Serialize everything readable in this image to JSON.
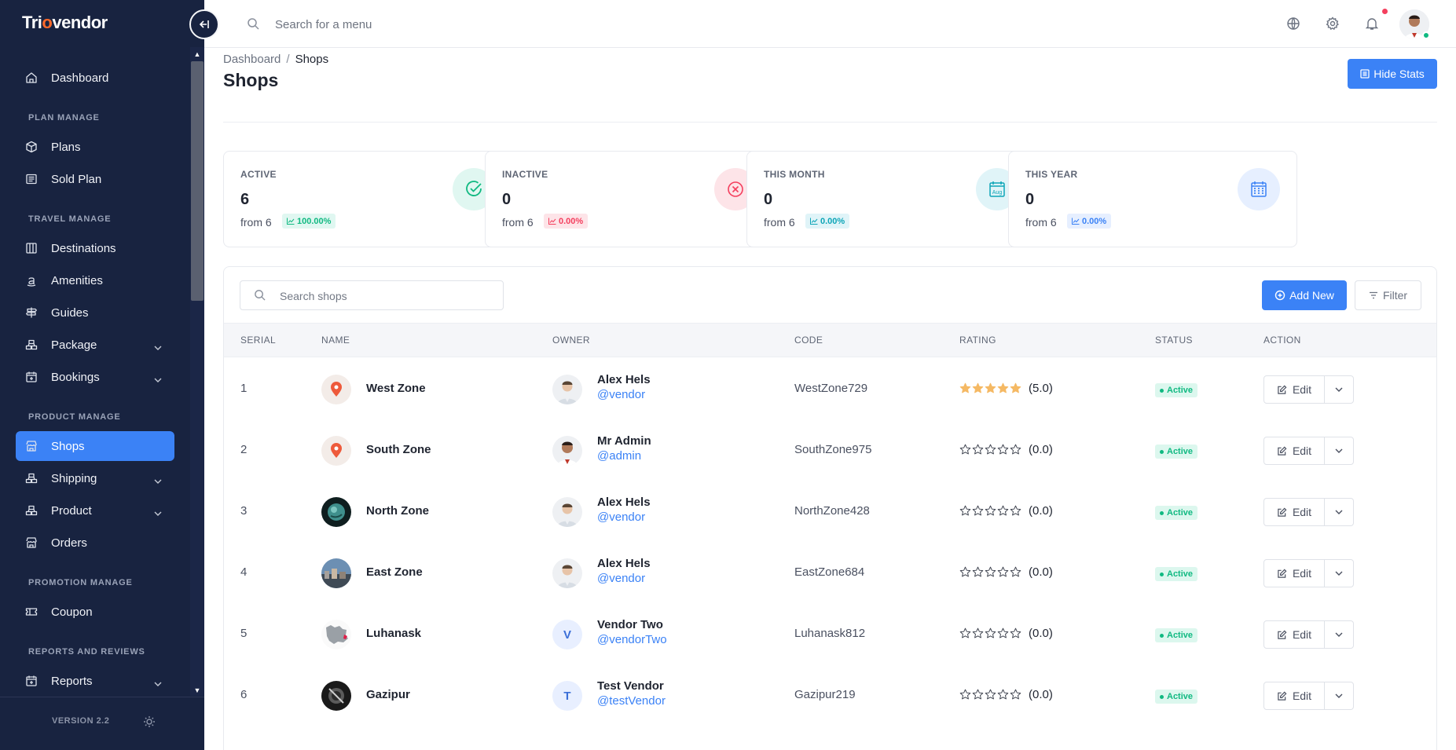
{
  "sidebar": {
    "logo_pre": "Tri",
    "logo_o": "o",
    "logo_post": "vendor",
    "logo_o2": "o",
    "logo_end": "r",
    "items": [
      {
        "label": "Dashboard",
        "icon": "home-icon"
      },
      {
        "section": "PLAN MANAGE"
      },
      {
        "label": "Plans",
        "icon": "cube-icon"
      },
      {
        "label": "Sold Plan",
        "icon": "receipt-icon"
      },
      {
        "section": "TRAVEL MANAGE"
      },
      {
        "label": "Destinations",
        "icon": "columns-icon"
      },
      {
        "label": "Amenities",
        "icon": "amazon-icon"
      },
      {
        "label": "Guides",
        "icon": "signpost-icon"
      },
      {
        "label": "Package",
        "icon": "boxes-icon",
        "expandable": true
      },
      {
        "label": "Bookings",
        "icon": "calendar-plus-icon",
        "expandable": true
      },
      {
        "section": "PRODUCT MANAGE"
      },
      {
        "label": "Shops",
        "icon": "store-icon",
        "active": true
      },
      {
        "label": "Shipping",
        "icon": "boxes-icon",
        "expandable": true
      },
      {
        "label": "Product",
        "icon": "boxes-icon",
        "expandable": true
      },
      {
        "label": "Orders",
        "icon": "store-icon"
      },
      {
        "section": "PROMOTION MANAGE"
      },
      {
        "label": "Coupon",
        "icon": "ticket-icon"
      },
      {
        "section": "REPORTS AND REVIEWS"
      },
      {
        "label": "Reports",
        "icon": "calendar-plus-icon",
        "expandable": true
      }
    ],
    "version": "VERSION 2.2"
  },
  "topbar": {
    "search_placeholder": "Search for a menu"
  },
  "breadcrumb": {
    "parent": "Dashboard",
    "separator": "/",
    "current": "Shops"
  },
  "page_title": "Shops",
  "hide_stats_label": "Hide Stats",
  "stats": [
    {
      "label": "ACTIVE",
      "value": "6",
      "from": "from 6",
      "pct": "100.00%",
      "color": "#10b981",
      "bg": "#e0f7f1",
      "icon": "check-circle-icon"
    },
    {
      "label": "INACTIVE",
      "value": "0",
      "from": "from 6",
      "pct": "0.00%",
      "color": "#f43f5e",
      "bg": "#fde4e8",
      "icon": "x-circle-icon"
    },
    {
      "label": "THIS MONTH",
      "value": "0",
      "from": "from 6",
      "pct": "0.00%",
      "color": "#0ea5b7",
      "bg": "#e0f4f8",
      "icon": "calendar-month-icon"
    },
    {
      "label": "THIS YEAR",
      "value": "0",
      "from": "from 6",
      "pct": "0.00%",
      "color": "#3b82f6",
      "bg": "#e6efff",
      "icon": "calendar-grid-icon"
    }
  ],
  "table": {
    "search_placeholder": "Search shops",
    "add_new_label": "Add New",
    "filter_label": "Filter",
    "headers": [
      "SERIAL",
      "NAME",
      "OWNER",
      "CODE",
      "RATING",
      "STATUS",
      "ACTION"
    ],
    "edit_label": "Edit",
    "rows": [
      {
        "serial": "1",
        "name": "West Zone",
        "img": "pin",
        "owner": "Alex Hels",
        "handle": "@vendor",
        "owner_img": "man",
        "code": "WestZone729",
        "stars": 5,
        "rating": "(5.0)",
        "status": "Active"
      },
      {
        "serial": "2",
        "name": "South Zone",
        "img": "pin",
        "owner": "Mr Admin",
        "handle": "@admin",
        "owner_img": "admin",
        "code": "SouthZone975",
        "stars": 0,
        "rating": "(0.0)",
        "status": "Active"
      },
      {
        "serial": "3",
        "name": "North Zone",
        "img": "globe",
        "owner": "Alex Hels",
        "handle": "@vendor",
        "owner_img": "man",
        "code": "NorthZone428",
        "stars": 0,
        "rating": "(0.0)",
        "status": "Active"
      },
      {
        "serial": "4",
        "name": "East Zone",
        "img": "city",
        "owner": "Alex Hels",
        "handle": "@vendor",
        "owner_img": "man",
        "code": "EastZone684",
        "stars": 0,
        "rating": "(0.0)",
        "status": "Active"
      },
      {
        "serial": "5",
        "name": "Luhanask",
        "img": "map",
        "owner": "Vendor Two",
        "handle": "@vendorTwo",
        "owner_letter": "V",
        "code": "Luhanask812",
        "stars": 0,
        "rating": "(0.0)",
        "status": "Active"
      },
      {
        "serial": "6",
        "name": "Gazipur",
        "img": "dark",
        "owner": "Test Vendor",
        "handle": "@testVendor",
        "owner_letter": "T",
        "code": "Gazipur219",
        "stars": 0,
        "rating": "(0.0)",
        "status": "Active"
      }
    ]
  },
  "colors": {
    "primary": "#3b82f6",
    "sidebar": "#182340",
    "star": "#f5b964"
  }
}
